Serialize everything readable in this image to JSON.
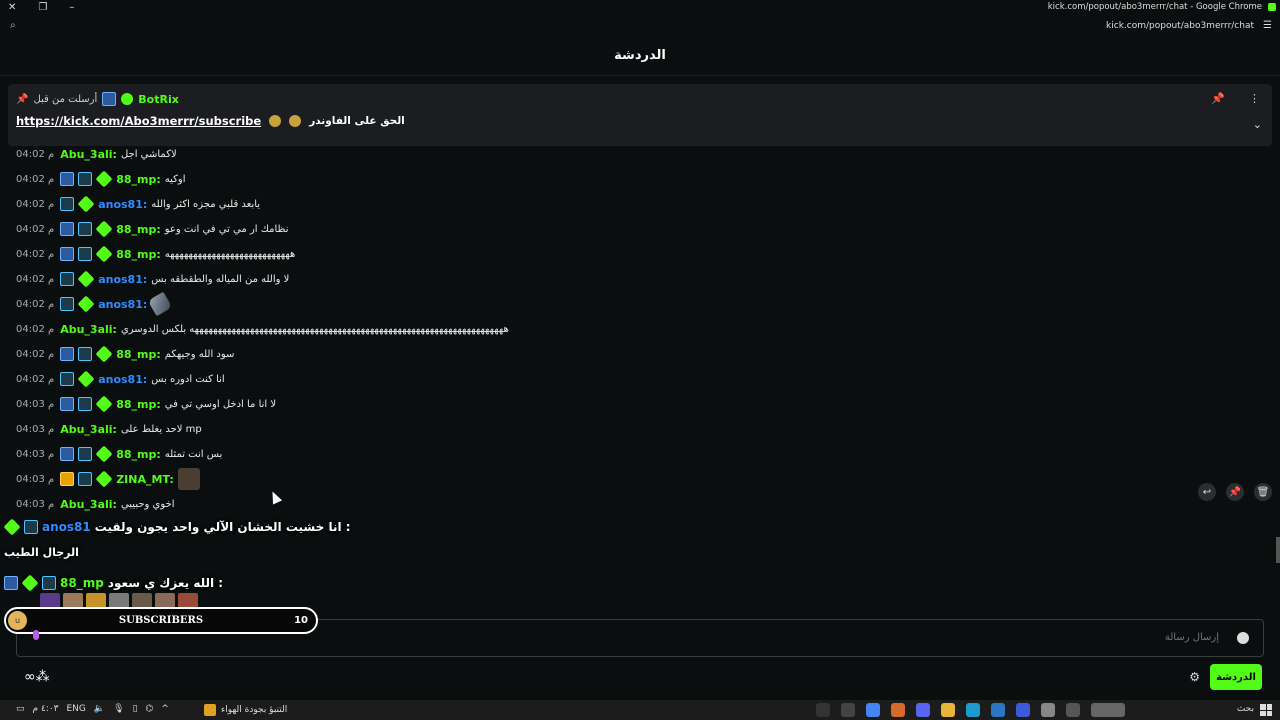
{
  "window": {
    "title": "kick.com/popout/abo3merrr/chat - Google Chrome",
    "url": "kick.com/popout/abo3merrr/chat"
  },
  "header": {
    "title": "الدردشة"
  },
  "pinned": {
    "sent_by_label": "أرسلت من قبل",
    "bot_name": "BotRix",
    "link": "https://kick.com/Abo3merrr/subscribe",
    "text": "الحق على الفاوندر"
  },
  "messages": [
    {
      "time": "04:02 م",
      "user": "Abu_3ali",
      "color": "#53fc18",
      "badges": [],
      "text": "لاكماشي اجل"
    },
    {
      "time": "04:02 م",
      "user": "88_mp",
      "color": "#53fc18",
      "badges": [
        "mod",
        "sub",
        "gem"
      ],
      "text": "اوكيه"
    },
    {
      "time": "04:02 م",
      "user": "anos81",
      "color": "#2f8cff",
      "badges": [
        "sub",
        "gem"
      ],
      "text": "يابعد قلبي مجزه اكثر والله"
    },
    {
      "time": "04:02 م",
      "user": "88_mp",
      "color": "#53fc18",
      "badges": [
        "mod",
        "sub",
        "gem"
      ],
      "text": "نظامك ار مي تي في انت وعو"
    },
    {
      "time": "04:02 م",
      "user": "88_mp",
      "color": "#53fc18",
      "badges": [
        "mod",
        "sub",
        "gem"
      ],
      "text": "هههههههههههههههههههههههههههه"
    },
    {
      "time": "04:02 م",
      "user": "anos81",
      "color": "#2f8cff",
      "badges": [
        "sub",
        "gem"
      ],
      "text": "لا والله من المياله والطقطقه بس"
    },
    {
      "time": "04:02 م",
      "user": "anos81",
      "color": "#2f8cff",
      "badges": [
        "sub",
        "gem"
      ],
      "text": ""
    },
    {
      "time": "04:02 م",
      "user": "Abu_3ali",
      "color": "#53fc18",
      "badges": [],
      "text": "ههههههههههههههههههههههههههههههههههههههههههههههههههههههههههههههههههههه بلكس الدوسري"
    },
    {
      "time": "04:02 م",
      "user": "88_mp",
      "color": "#53fc18",
      "badges": [
        "mod",
        "sub",
        "gem"
      ],
      "text": "سود الله وجيهكم"
    },
    {
      "time": "04:02 م",
      "user": "anos81",
      "color": "#2f8cff",
      "badges": [
        "sub",
        "gem"
      ],
      "text": "انا كنت ادوره بس"
    },
    {
      "time": "04:03 م",
      "user": "88_mp",
      "color": "#53fc18",
      "badges": [
        "mod",
        "sub",
        "gem"
      ],
      "text": "لا انا ما ادخل اوسي تي في"
    },
    {
      "time": "04:03 م",
      "user": "Abu_3ali",
      "color": "#53fc18",
      "badges": [],
      "text": "لاحد يغلط على mp"
    },
    {
      "time": "04:03 م",
      "user": "88_mp",
      "color": "#53fc18",
      "badges": [
        "mod",
        "sub",
        "gem"
      ],
      "text": "بس انت تمثله"
    },
    {
      "time": "04:03 م",
      "user": "ZINA_MT",
      "color": "#53fc18",
      "badges": [
        "crown",
        "sub",
        "gem"
      ],
      "text": ""
    },
    {
      "time": "04:03 م",
      "user": "Abu_3ali",
      "color": "#53fc18",
      "badges": [],
      "text": "اخوي وحبيبي"
    },
    {
      "time": "04:03 م",
      "user": "anos81",
      "color": "#2f8cff",
      "badges": [
        "sub",
        "gem"
      ],
      "text": "انا خشيت"
    },
    {
      "time": "04:03 م",
      "user": "88_mp",
      "color": "#53fc18",
      "badges": [
        "mod",
        "sub",
        "gem"
      ],
      "text": "الله يعزك ي سود"
    }
  ],
  "overlay": {
    "line1_user": "anos81",
    "line1_text": "انا خشيت الخشان الآلي واحد يجون ولقيت :",
    "line2_text": "الرجال الطيب",
    "line3_user": "88_mp",
    "line3_text": "الله يعزك ي سعود :"
  },
  "sub_widget": {
    "label": "SUBSCRIBERS",
    "count": "10",
    "avatar_letter": "u"
  },
  "input": {
    "placeholder": "إرسال رسالة"
  },
  "bottom": {
    "chat_button": "الدردشة"
  },
  "taskbar": {
    "time": "٤:٠٣ م",
    "lang": "ENG",
    "weather": "التنبؤ بجودة الهواء",
    "search": "بحث"
  },
  "colors": {
    "accent": "#53fc18",
    "bg": "#0b0e0f",
    "pinned_bg": "#1b1d20",
    "blue_user": "#2f8cff"
  }
}
